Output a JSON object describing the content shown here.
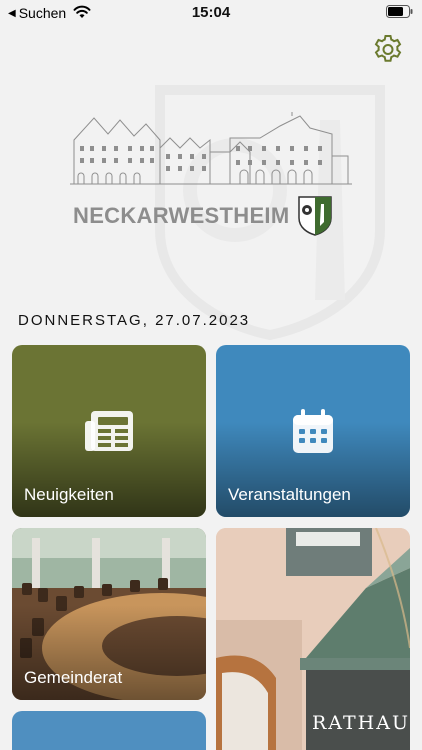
{
  "status_bar": {
    "back_label": "Suchen",
    "time": "15:04"
  },
  "header": {
    "town_name": "NECKARWESTHEIM",
    "date": "DONNERSTAG, 27.07.2023"
  },
  "tiles": [
    {
      "label": "Neuigkeiten",
      "icon": "newspaper-icon",
      "color": "#6b7434"
    },
    {
      "label": "Veranstaltungen",
      "icon": "calendar-icon",
      "color": "#3f89bd"
    },
    {
      "label": "Gemeinderat",
      "icon": "council-photo"
    },
    {
      "label": "",
      "sign_text": "RATHAUS",
      "icon": "town-hall-photo"
    },
    {
      "label": "",
      "color": "#4f8fc0"
    }
  ],
  "colors": {
    "accent": "#6b7a2e",
    "background": "#f2f2f2"
  }
}
